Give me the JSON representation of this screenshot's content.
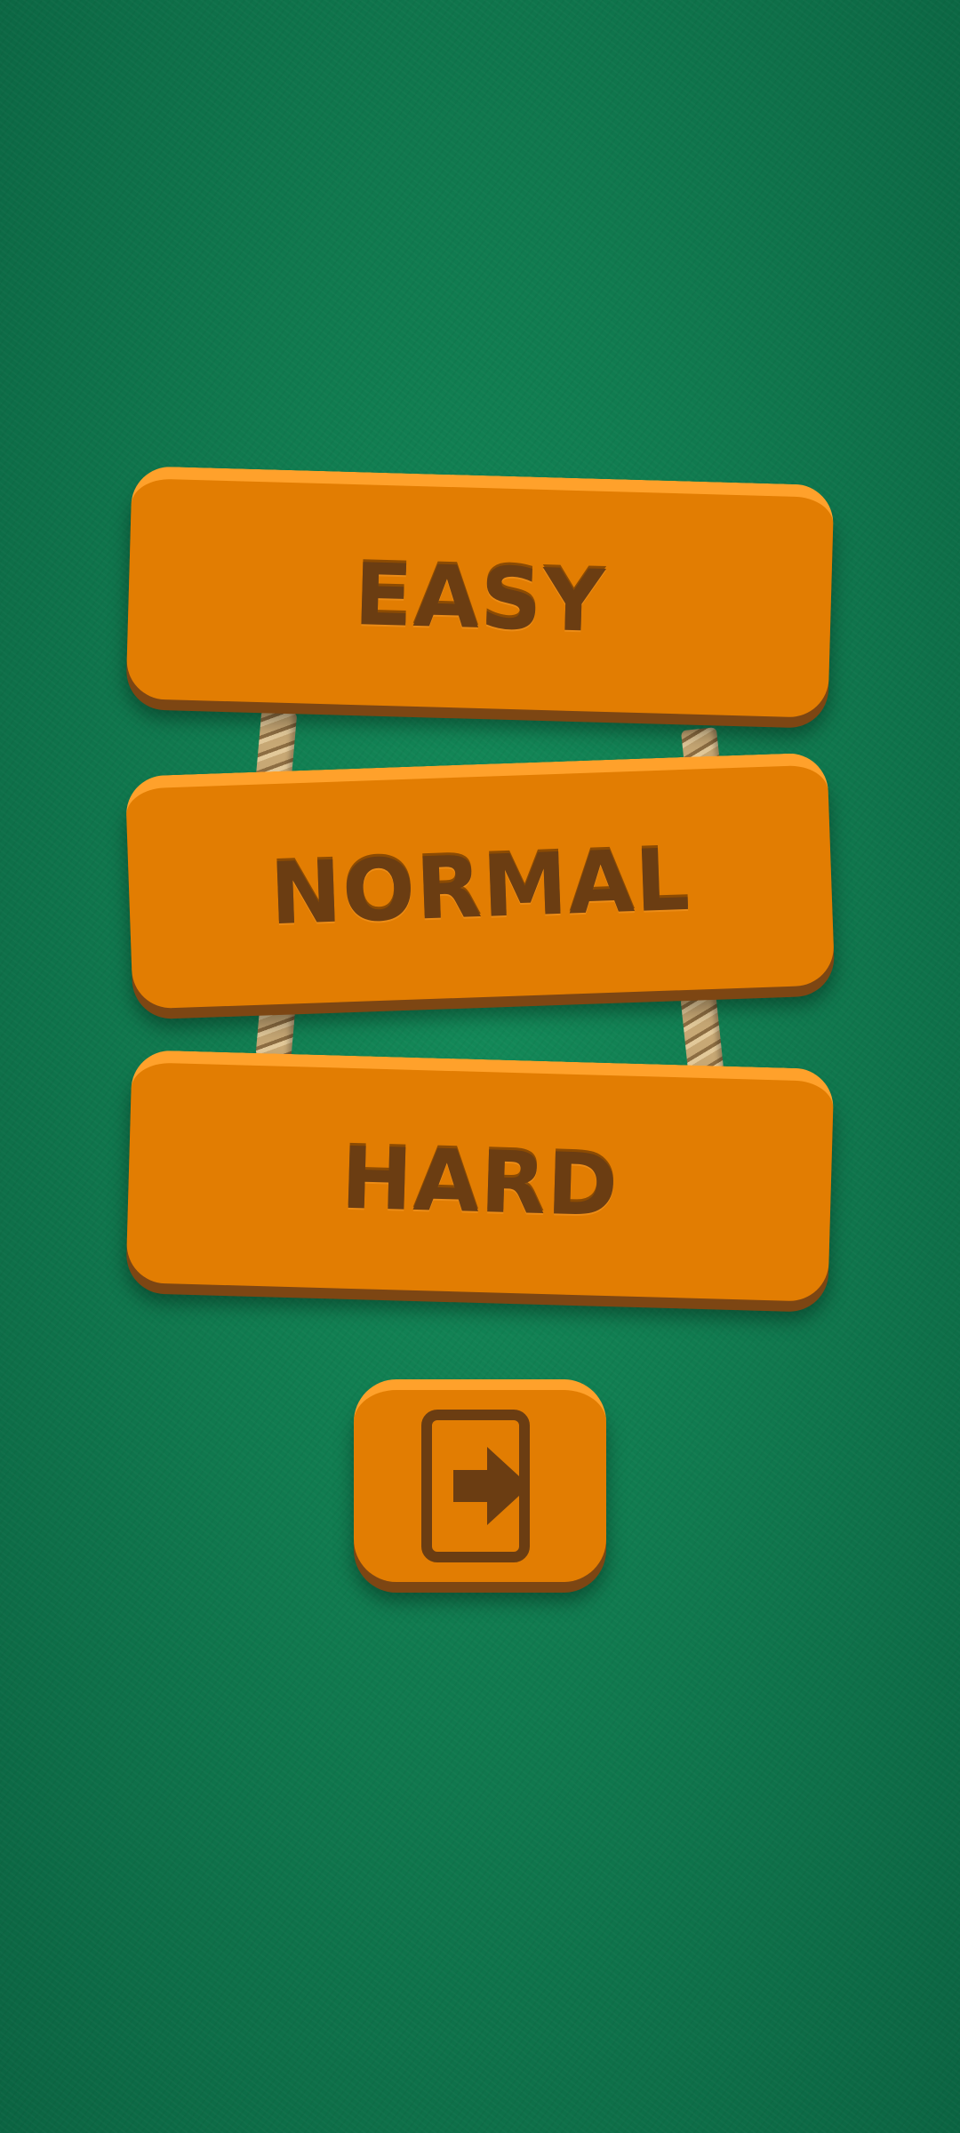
{
  "menu": {
    "difficulties": [
      {
        "label": "EASY"
      },
      {
        "label": "NORMAL"
      },
      {
        "label": "HARD"
      }
    ],
    "exit_icon": "exit-door-arrow-icon"
  },
  "colors": {
    "background": "#107a4f",
    "sign_face": "#e27d02",
    "sign_highlight": "#ffa12b",
    "sign_shadow": "#7d4613",
    "label_text": "#6b3d12"
  }
}
